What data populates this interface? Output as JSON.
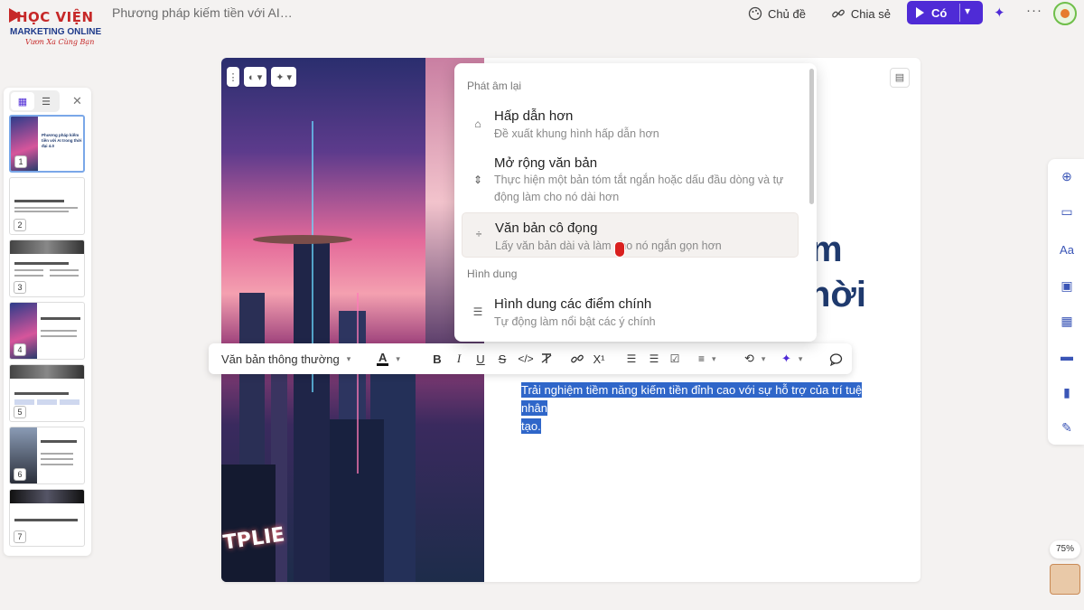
{
  "header": {
    "logo_line1": "HỌC VIỆN",
    "logo_line2": "MARKETING ONLINE",
    "logo_line3": "Vươn Xa Cùng Bạn",
    "doc_title": "Phương pháp kiếm tiền với AI trong thời đ...",
    "theme_label": "Chủ đề",
    "share_label": "Chia sẻ",
    "present_label": "Có",
    "accent_color": "#4f2bd6"
  },
  "slides_panel": {
    "slides": [
      {
        "number": "1",
        "title": "Phương pháp kiếm tiền với AI trong thời đại 4.0"
      },
      {
        "number": "2",
        "title": ""
      },
      {
        "number": "3",
        "title": ""
      },
      {
        "number": "4",
        "title": ""
      },
      {
        "number": "5",
        "title": ""
      },
      {
        "number": "6",
        "title": ""
      },
      {
        "number": "7",
        "title": ""
      }
    ]
  },
  "slide": {
    "title_fragment_1": "m",
    "title_fragment_2": "hời",
    "image_sign": "TPLIE",
    "selected_line1": "Trải nghiệm tiềm năng kiếm tiền đỉnh cao với sự hỗ trợ của trí tuệ nhân",
    "selected_line2": "tạo."
  },
  "toolbar": {
    "text_style": "Văn bản thông thường",
    "bold": "B",
    "italic": "I",
    "underline": "U",
    "strike": "S",
    "code": "</>",
    "superscript": "X¹"
  },
  "menu": {
    "group_rewrite": "Phát âm lại",
    "group_visualize": "Hình dung",
    "items": [
      {
        "title": "Hấp dẫn hơn",
        "desc": "Đề xuất khung hình hấp dẫn hơn",
        "icon": "frame-icon"
      },
      {
        "title": "Mở rộng văn bản",
        "desc": "Thực hiện một bản tóm tắt ngắn hoặc dấu đầu dòng và tự động làm cho nó dài hơn",
        "icon": "expand-icon"
      },
      {
        "title": "Văn bản cô đọng",
        "desc": "Lấy văn bản dài và làm cho nó ngắn gọn hơn",
        "icon": "condense-icon"
      },
      {
        "title": "Hình dung các điểm chính",
        "desc": "Tự động làm nổi bật các ý chính",
        "icon": "list-icon"
      }
    ]
  },
  "zoom": {
    "level": "75%"
  }
}
